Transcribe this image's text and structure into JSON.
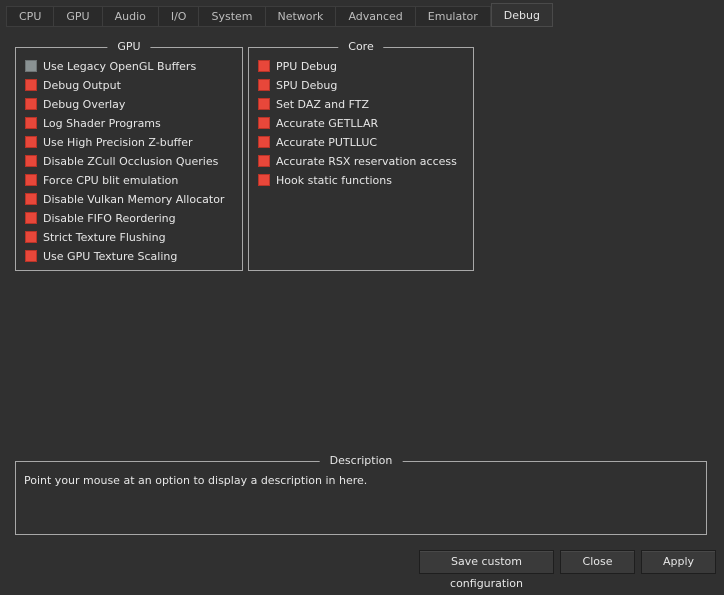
{
  "tabs": [
    "CPU",
    "GPU",
    "Audio",
    "I/O",
    "System",
    "Network",
    "Advanced",
    "Emulator",
    "Debug"
  ],
  "active_tab": "Debug",
  "gpu_group": {
    "title": "GPU",
    "items": [
      {
        "label": "Use Legacy OpenGL Buffers",
        "checked": false
      },
      {
        "label": "Debug Output",
        "checked": true
      },
      {
        "label": "Debug Overlay",
        "checked": true
      },
      {
        "label": "Log Shader Programs",
        "checked": true
      },
      {
        "label": "Use High Precision Z-buffer",
        "checked": true
      },
      {
        "label": "Disable ZCull Occlusion Queries",
        "checked": true
      },
      {
        "label": "Force CPU blit emulation",
        "checked": true
      },
      {
        "label": "Disable Vulkan Memory Allocator",
        "checked": true
      },
      {
        "label": "Disable FIFO Reordering",
        "checked": true
      },
      {
        "label": "Strict Texture Flushing",
        "checked": true
      },
      {
        "label": "Use GPU Texture Scaling",
        "checked": true
      }
    ]
  },
  "core_group": {
    "title": "Core",
    "items": [
      {
        "label": "PPU Debug",
        "checked": true
      },
      {
        "label": "SPU Debug",
        "checked": true
      },
      {
        "label": "Set DAZ and FTZ",
        "checked": true
      },
      {
        "label": "Accurate GETLLAR",
        "checked": true
      },
      {
        "label": "Accurate PUTLLUC",
        "checked": true
      },
      {
        "label": "Accurate RSX reservation access",
        "checked": true
      },
      {
        "label": "Hook static functions",
        "checked": true
      }
    ]
  },
  "description": {
    "title": "Description",
    "text": "Point your mouse at an option to display a description in here."
  },
  "buttons": {
    "save": "Save custom configuration",
    "close": "Close",
    "apply": "Apply"
  }
}
